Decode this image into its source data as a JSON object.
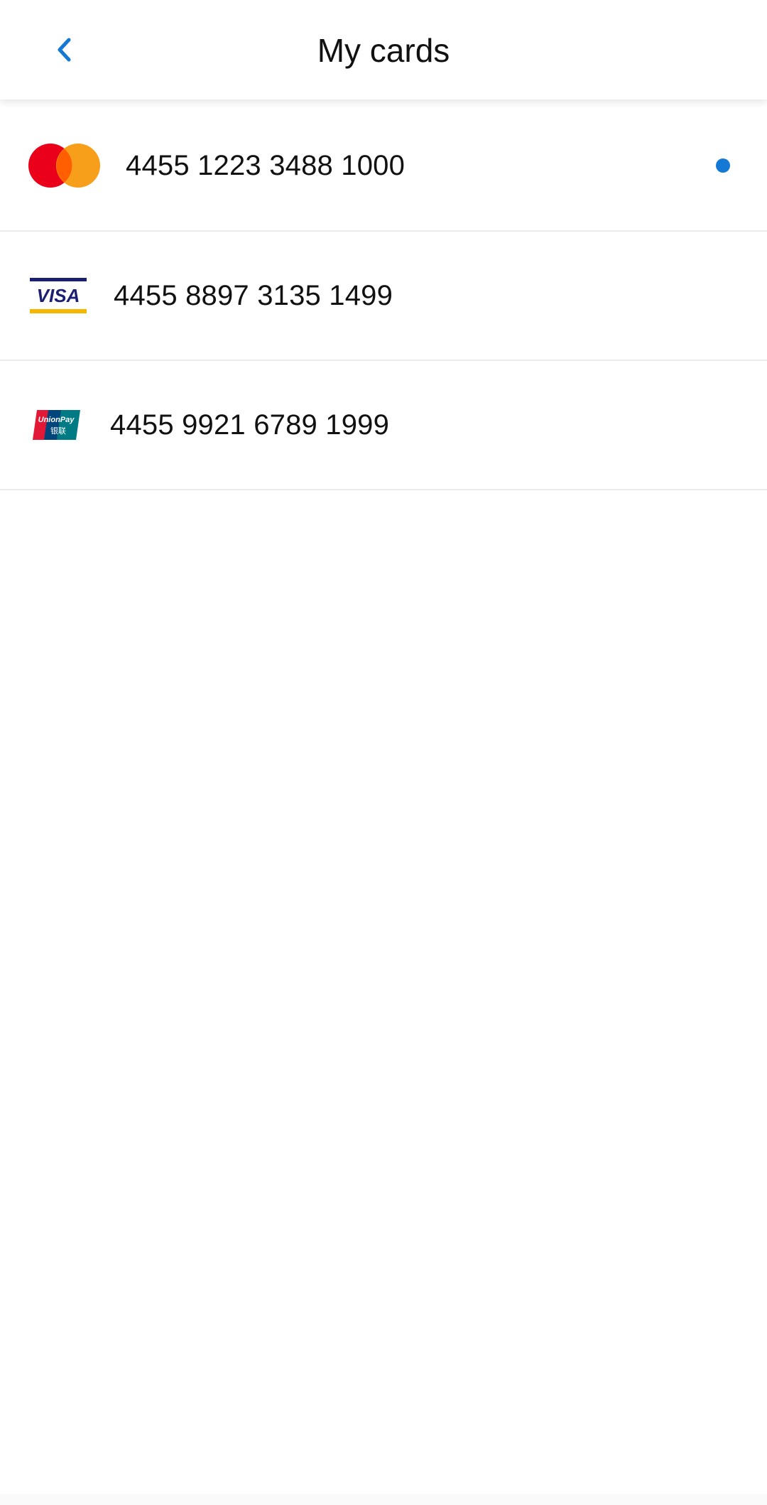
{
  "header": {
    "title": "My cards",
    "back_icon": "chevron-left-icon"
  },
  "cards": [
    {
      "brand": "mastercard",
      "number": "4455 1223 3488 1000",
      "selected": true
    },
    {
      "brand": "visa",
      "number": "4455 8897 3135 1499",
      "selected": false
    },
    {
      "brand": "unionpay",
      "number": "4455 9921 6789 1999",
      "selected": false
    }
  ],
  "logos": {
    "visa_text": "VISA",
    "unionpay_text": "UnionPay",
    "unionpay_cn": "银联"
  },
  "colors": {
    "accent": "#1479d4",
    "mastercard_red": "#eb001b",
    "mastercard_orange": "#f79e1b",
    "visa_blue": "#1a1f71",
    "visa_gold": "#f7b600",
    "divider": "#ebebeb"
  }
}
